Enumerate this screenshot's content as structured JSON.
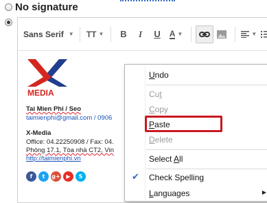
{
  "options": {
    "no_signature_label": "No signature"
  },
  "toolbar": {
    "font_family": "Sans Serif",
    "font_size_icon": "ΤT",
    "bold": "B",
    "italic": "I",
    "underline": "U",
    "text_color": "A"
  },
  "signature": {
    "logo_text": "MEDIA",
    "name_line": "Tai Mien Phi / Seo",
    "email_line": "taimienphi@gmail.com / 0906",
    "company": "X-Media",
    "office_line": "Office: 04.22250908 / Fax: 04.",
    "address_line": "Phòng 17.1, Tòa nhà CT2, Vin",
    "website": "http://taimienphi.vn",
    "social_icons": [
      "facebook-icon",
      "twitter-icon",
      "google-plus-icon",
      "youtube-icon",
      "skype-icon"
    ]
  },
  "context_menu": {
    "undo": {
      "label": "Undo",
      "accel": "U",
      "rest": "ndo"
    },
    "cut": {
      "label": "Cut",
      "pre": "Cu",
      "accel": "t",
      "rest": ""
    },
    "copy": {
      "label": "Copy",
      "pre": "",
      "accel": "C",
      "rest": "opy"
    },
    "paste": {
      "label": "Paste",
      "accel": "P",
      "rest": "aste"
    },
    "delete": {
      "label": "Delete",
      "accel": "D",
      "rest": "elete"
    },
    "select_all": {
      "label": "Select All",
      "pre": "Select ",
      "accel": "A",
      "rest": "ll"
    },
    "check_spelling": {
      "label": "Check Spelling"
    },
    "languages": {
      "label": "Languages",
      "accel": "L",
      "rest": "anguages"
    }
  },
  "colors": {
    "logo_red": "#d4261f",
    "logo_blue": "#1f3f8f",
    "highlight_border": "#c8191f",
    "link": "#1a55b8"
  }
}
